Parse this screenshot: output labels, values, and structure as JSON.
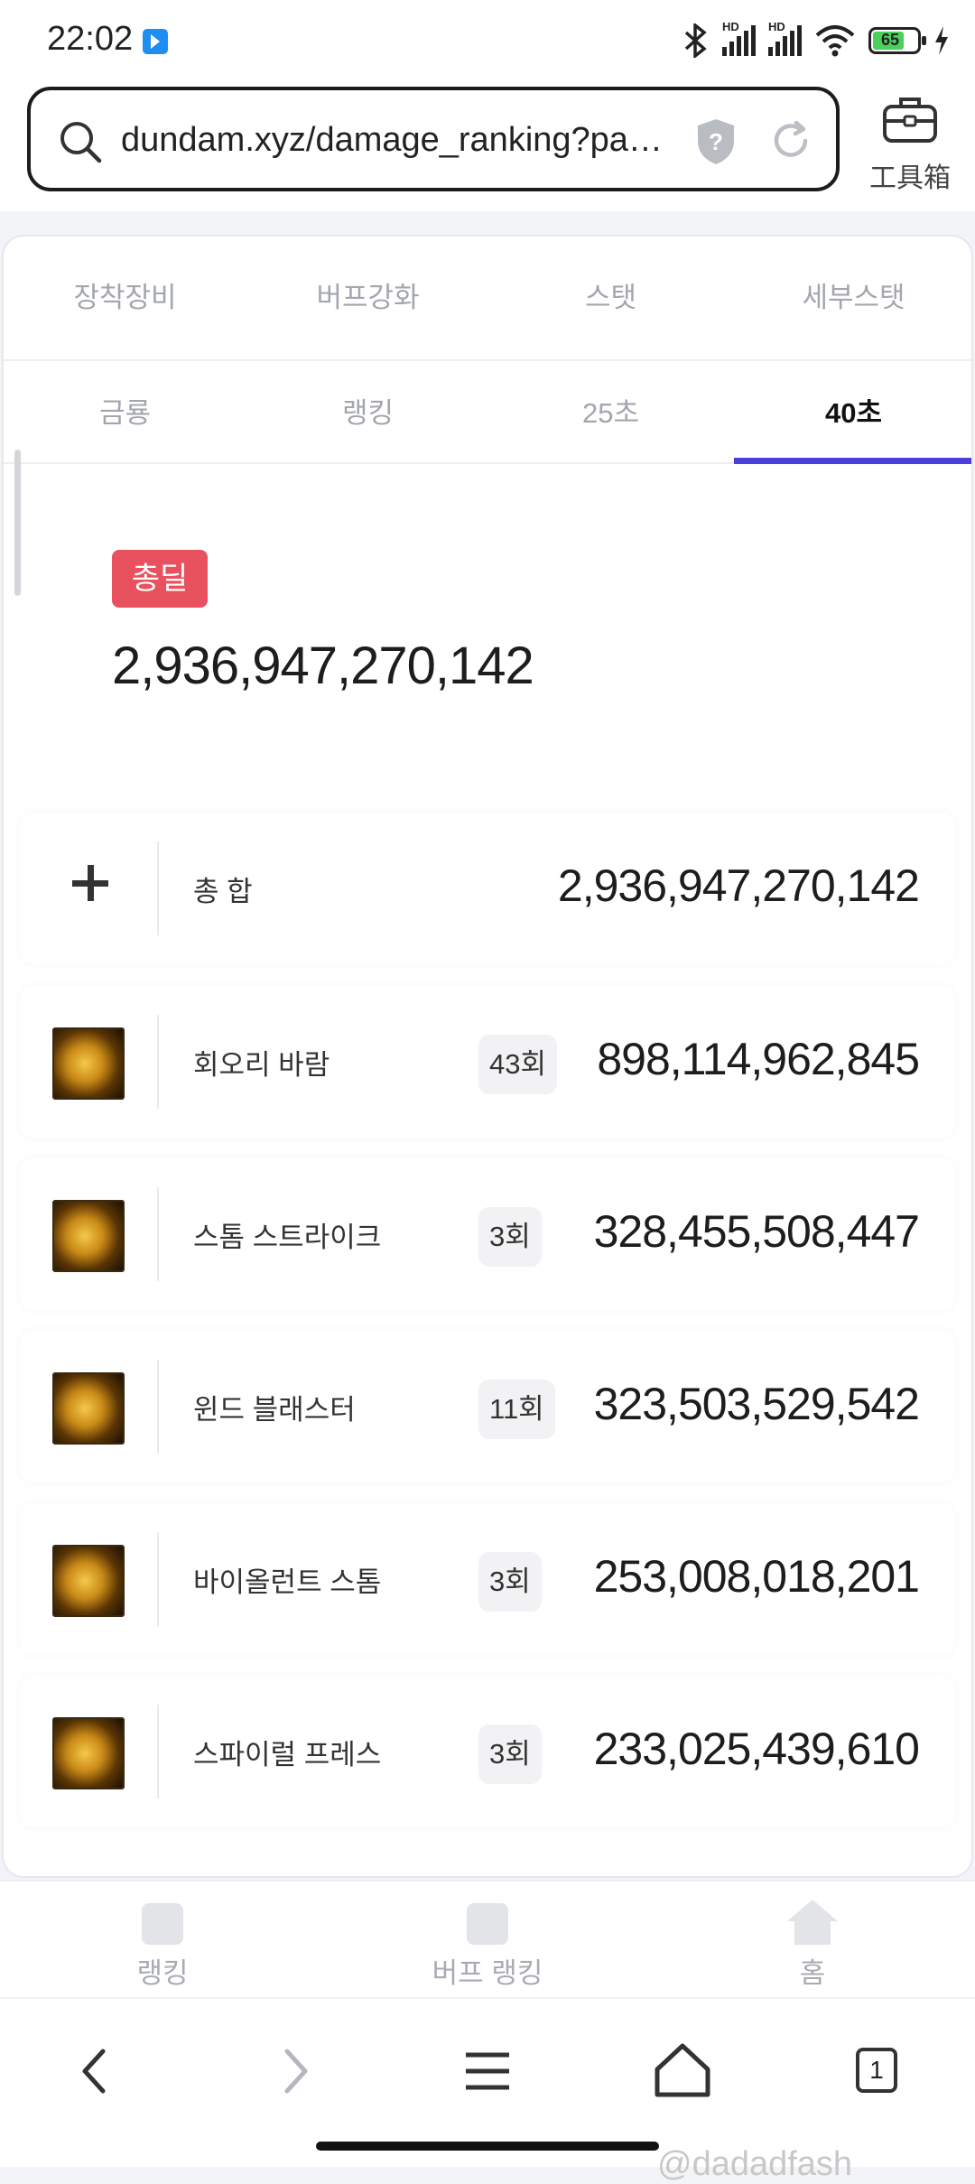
{
  "status_bar": {
    "time": "22:02",
    "battery": "65",
    "hd1": "HD",
    "hd2": "HD"
  },
  "browser": {
    "url": "dundam.xyz/damage_ranking?pa…",
    "toolbox_label": "工具箱",
    "tab_count": "1"
  },
  "tabs_primary": [
    "장착장비",
    "버프강화",
    "스탯",
    "세부스탯"
  ],
  "tabs_secondary": [
    "금룡",
    "랭킹",
    "25초",
    "40초"
  ],
  "active_secondary_tab": "40초",
  "summary": {
    "badge": "총딜",
    "total": "2,936,947,270,142"
  },
  "total_row": {
    "name": "총 합",
    "value": "2,936,947,270,142"
  },
  "skills": [
    {
      "name": "회오리 바람",
      "count": "43회",
      "value": "898,114,962,845"
    },
    {
      "name": "스톰 스트라이크",
      "count": "3회",
      "value": "328,455,508,447"
    },
    {
      "name": "윈드 블래스터",
      "count": "11회",
      "value": "323,503,529,542"
    },
    {
      "name": "바이올런트 스톰",
      "count": "3회",
      "value": "253,008,018,201"
    },
    {
      "name": "스파이럴 프레스",
      "count": "3회",
      "value": "233,025,439,610"
    }
  ],
  "site_nav": [
    "랭킹",
    "버프 랭킹",
    "홈"
  ],
  "watermark": "@dadadfash",
  "colors": {
    "accent": "#4a3fd8",
    "badge": "#e8515e",
    "battery": "#4bd05c"
  }
}
